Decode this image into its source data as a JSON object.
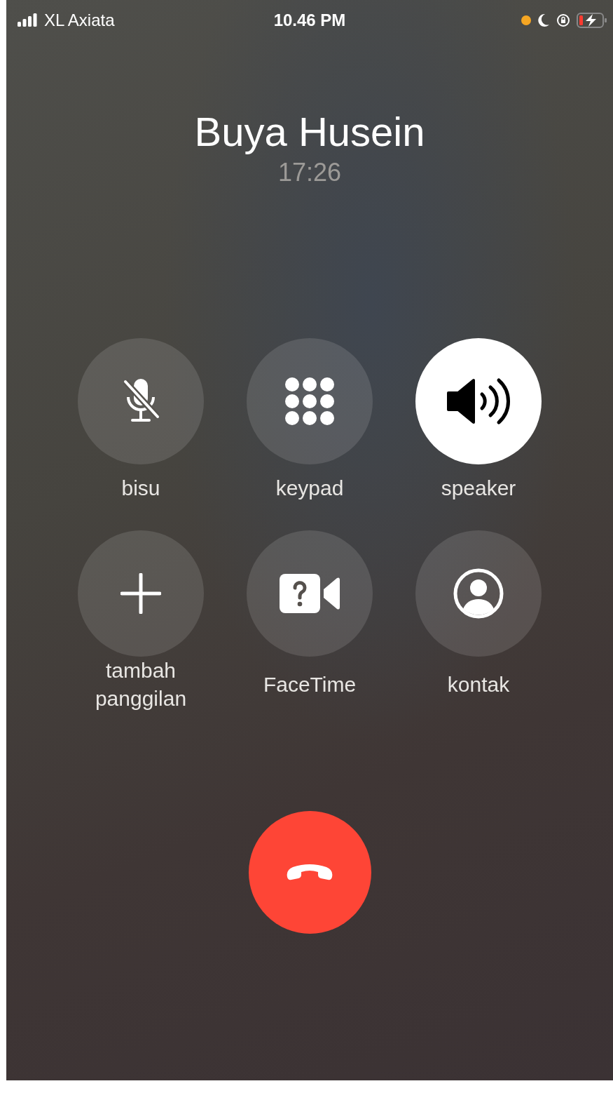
{
  "status_bar": {
    "carrier": "XL Axiata",
    "time": "10.46 PM"
  },
  "call": {
    "name": "Buya Husein",
    "duration": "17:26"
  },
  "controls": [
    {
      "kind": "mute",
      "label": "bisu",
      "on": false
    },
    {
      "kind": "keypad",
      "label": "keypad",
      "on": false
    },
    {
      "kind": "speaker",
      "label": "speaker",
      "on": true
    },
    {
      "kind": "add",
      "label": "tambah panggilan",
      "on": false
    },
    {
      "kind": "facetime",
      "label": "FaceTime",
      "on": false
    },
    {
      "kind": "contacts",
      "label": "kontak",
      "on": false
    }
  ]
}
